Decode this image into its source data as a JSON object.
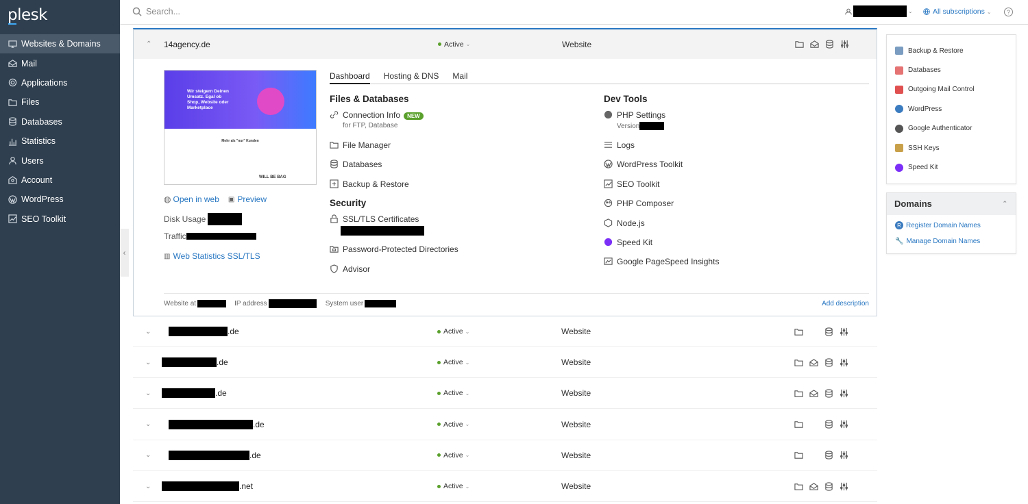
{
  "app": {
    "logo": "plesk"
  },
  "sidebar": {
    "items": [
      {
        "label": "Websites & Domains",
        "icon": "monitor-icon",
        "active": true
      },
      {
        "label": "Mail",
        "icon": "mail-icon"
      },
      {
        "label": "Applications",
        "icon": "gear-icon"
      },
      {
        "label": "Files",
        "icon": "folder-icon"
      },
      {
        "label": "Databases",
        "icon": "database-icon"
      },
      {
        "label": "Statistics",
        "icon": "stats-icon"
      },
      {
        "label": "Users",
        "icon": "user-icon"
      },
      {
        "label": "Account",
        "icon": "account-icon"
      },
      {
        "label": "WordPress",
        "icon": "wordpress-icon"
      },
      {
        "label": "SEO Toolkit",
        "icon": "seo-icon"
      }
    ]
  },
  "topbar": {
    "search_placeholder": "Search...",
    "subscriptions": "All subscriptions",
    "help": "?"
  },
  "expanded": {
    "domain": "14agency.de",
    "status": "Active",
    "type": "Website",
    "thumb": {
      "headline": "Wir steigern Deinen Umsatz. Egal ob Shop, Website oder Marketplace",
      "subheading": "Mehr als \"nur\" Kunden",
      "brand": "WILL BE BAG"
    },
    "open_in_web": "Open in web",
    "preview": "Preview",
    "disk_usage": "Disk Usage",
    "traffic": "Traffic",
    "web_stats": "Web Statistics SSL/TLS",
    "tabs": [
      "Dashboard",
      "Hosting & DNS",
      "Mail"
    ],
    "files_db": {
      "title": "Files & Databases",
      "connection": "Connection Info",
      "new_badge": "NEW",
      "connection_sub": "for FTP, Database",
      "file_manager": "File Manager",
      "databases": "Databases",
      "backup": "Backup & Restore"
    },
    "security": {
      "title": "Security",
      "ssl": "SSL/TLS Certificates",
      "pwd_dirs": "Password-Protected Directories",
      "advisor": "Advisor"
    },
    "dev": {
      "title": "Dev Tools",
      "php": "PHP Settings",
      "php_sub": "Version",
      "logs": "Logs",
      "wp_toolkit": "WordPress Toolkit",
      "seo": "SEO Toolkit",
      "composer": "PHP Composer",
      "node": "Node.js",
      "speedkit": "Speed Kit",
      "pagespeed": "Google PageSpeed Insights"
    },
    "footer": {
      "website_at": "Website at",
      "ip": "IP address",
      "sysuser": "System user",
      "add_desc": "Add description"
    }
  },
  "rows": [
    {
      "suffix": ".de",
      "status": "Active",
      "type": "Website",
      "mail": false
    },
    {
      "suffix": ".de",
      "status": "Active",
      "type": "Website",
      "mail": true
    },
    {
      "suffix": ".de",
      "status": "Active",
      "type": "Website",
      "mail": true
    },
    {
      "suffix": ".de",
      "status": "Active",
      "type": "Website",
      "mail": false
    },
    {
      "suffix": ".de",
      "status": "Active",
      "type": "Website",
      "mail": false
    },
    {
      "suffix": ".net",
      "status": "Active",
      "type": "Website",
      "mail": true
    }
  ],
  "right_panel": {
    "items": [
      {
        "label": "Backup & Restore",
        "color": "#7a9cc0"
      },
      {
        "label": "Databases",
        "color": "#e57373"
      },
      {
        "label": "Outgoing Mail Control",
        "color": "#e05050"
      },
      {
        "label": "WordPress",
        "color": "#3b7bbf"
      },
      {
        "label": "Google Authenticator",
        "color": "#555555"
      },
      {
        "label": "SSH Keys",
        "color": "#c9a04a"
      },
      {
        "label": "Speed Kit",
        "color": "#7b2ff7"
      }
    ],
    "domains_title": "Domains",
    "register": "Register Domain Names",
    "manage": "Manage Domain Names"
  }
}
